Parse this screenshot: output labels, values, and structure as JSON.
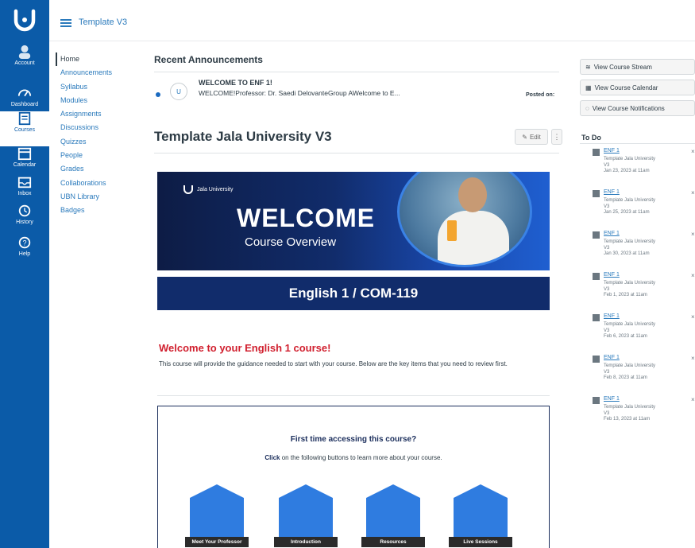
{
  "header": {
    "breadcrumb": "Template V3"
  },
  "global_nav": [
    {
      "label": "Account",
      "icon": "account-icon"
    },
    {
      "label": "Dashboard",
      "icon": "dashboard-icon"
    },
    {
      "label": "Courses",
      "icon": "courses-icon"
    },
    {
      "label": "Calendar",
      "icon": "calendar-icon"
    },
    {
      "label": "Inbox",
      "icon": "inbox-icon"
    },
    {
      "label": "History",
      "icon": "history-icon"
    },
    {
      "label": "Help",
      "icon": "help-icon"
    }
  ],
  "course_nav": [
    "Home",
    "Announcements",
    "Syllabus",
    "Modules",
    "Assignments",
    "Discussions",
    "Quizzes",
    "People",
    "Grades",
    "Collaborations",
    "UBN Library",
    "Badges"
  ],
  "announcements": {
    "title": "Recent Announcements",
    "item": {
      "avatar": "U",
      "heading": "WELCOME TO ENF 1!",
      "preview": "WELCOME!Professor: Dr. Saedi DelovanteGroup AWelcome to E...",
      "posted": "Posted on:"
    }
  },
  "page": {
    "title": "Template Jala University V3",
    "edit_label": "Edit",
    "more_label": "⋮"
  },
  "banner": {
    "brand": "Jala University",
    "welcome": "WELCOME",
    "overview": "Course Overview"
  },
  "course_bar": "English 1 / COM-119",
  "intro": {
    "heading": "Welcome to your English 1 course!",
    "text": "This course will provide the guidance needed to start with your course. Below are the key items that you need to review first."
  },
  "access": {
    "question": "First time accessing this course?",
    "click": "Click",
    "instruction": " on the following buttons to learn more about your course.",
    "tiles": [
      "Meet Your Professor",
      "Introduction",
      "Resources",
      "Live Sessions"
    ]
  },
  "right": {
    "buttons": [
      "View Course Stream",
      "View Course Calendar",
      "View Course Notifications"
    ],
    "todo_title": "To Do",
    "todo": [
      {
        "title": "ENF 1",
        "course": "Template Jala University V3",
        "date": "Jan 23, 2023 at 11am"
      },
      {
        "title": "ENF 1",
        "course": "Template Jala University V3",
        "date": "Jan 25, 2023 at 11am"
      },
      {
        "title": "ENF 1",
        "course": "Template Jala University V3",
        "date": "Jan 30, 2023 at 11am"
      },
      {
        "title": "ENF 1",
        "course": "Template Jala University V3",
        "date": "Feb 1, 2023 at 11am"
      },
      {
        "title": "ENF 1",
        "course": "Template Jala University V3",
        "date": "Feb 6, 2023 at 11am"
      },
      {
        "title": "ENF 1",
        "course": "Template Jala University V3",
        "date": "Feb 8, 2023 at 11am"
      },
      {
        "title": "ENF 1",
        "course": "Template Jala University V3",
        "date": "Feb 13, 2023 at 11am"
      }
    ]
  },
  "colors": {
    "nav_blue": "#0b5ba8",
    "banner_navy": "#112c6b",
    "accent_red": "#d1202f",
    "link_blue": "#2a7abc"
  }
}
